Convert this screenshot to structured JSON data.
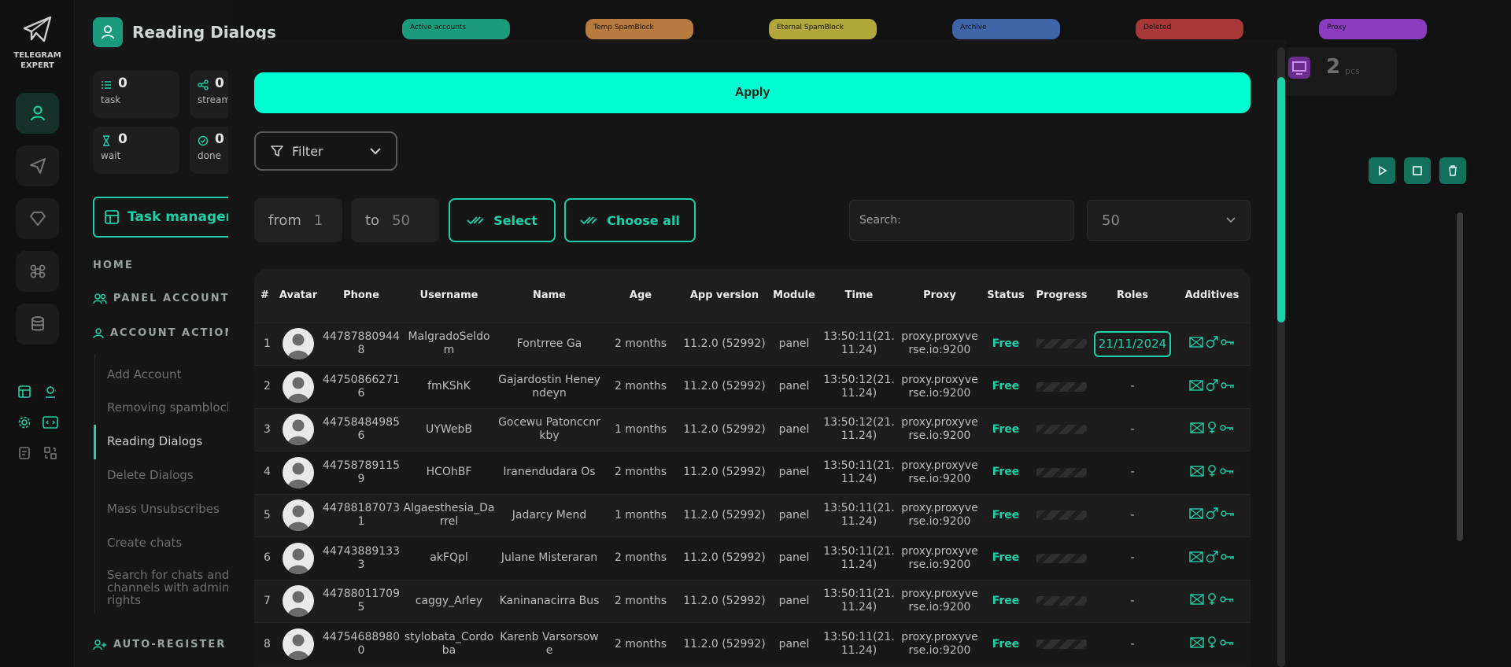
{
  "app": {
    "logo_line1": "TELEGRAM",
    "logo_line2": "EXPERT"
  },
  "page": {
    "title": "Reading Dialogs"
  },
  "stats": [
    {
      "value": "0",
      "label": "task"
    },
    {
      "value": "0",
      "label": "stream"
    },
    {
      "value": "0",
      "label": "wait"
    },
    {
      "value": "0",
      "label": "done"
    }
  ],
  "task_manager_label": "Task manager",
  "nav": {
    "home": "HOME",
    "panel_accounts": "PANEL ACCOUNTS",
    "account_action": "ACCOUNT ACTION",
    "items": [
      "Add Account",
      "Removing spamblock",
      "Reading Dialogs",
      "Delete Dialogs",
      "Mass Unsubscribes",
      "Create chats",
      "Search for chats and channels with admin rights"
    ],
    "auto_register": "AUTO-REGISTER"
  },
  "status_tabs": [
    {
      "label": "Active accounts",
      "color": "#1c9a7d"
    },
    {
      "label": "Temp SpamBlock",
      "color": "#b77a3f"
    },
    {
      "label": "Eternal SpamBlock",
      "color": "#b2a73a"
    },
    {
      "label": "Archive",
      "color": "#3f64a8"
    },
    {
      "label": "Deleted",
      "color": "#a83838"
    },
    {
      "label": "Proxy",
      "color": "#8a3dbf"
    }
  ],
  "proxy_card": {
    "value": "2",
    "unit": "pcs"
  },
  "modal": {
    "apply_label": "Apply",
    "filter_label": "Filter",
    "from_label": "from",
    "from_value": "1",
    "to_label": "to",
    "to_value": "50",
    "select_label": "Select",
    "choose_all_label": "Choose all",
    "search_placeholder": "Search:",
    "per_page": "50"
  },
  "table": {
    "headers": [
      "#",
      "Avatar",
      "Phone",
      "Username",
      "Name",
      "Age",
      "App version",
      "Module",
      "Time",
      "Proxy",
      "Status",
      "Progress",
      "Roles",
      "Additives"
    ],
    "rows": [
      {
        "num": "1",
        "phone": "447878809448",
        "username": "MalgradoSeldom",
        "name": "Fontrree Ga",
        "age": "2 months",
        "app": "11.2.0 (52992)",
        "module": "panel",
        "time": "13:50:11(21.11.24)",
        "proxy": "proxy.proxyverse.io:9200",
        "status": "Free",
        "roles": "21/11/2024",
        "gender": "male"
      },
      {
        "num": "2",
        "phone": "447508662716",
        "username": "fmKShK",
        "name": "Gajardostin Heneyndeyn",
        "age": "2 months",
        "app": "11.2.0 (52992)",
        "module": "panel",
        "time": "13:50:12(21.11.24)",
        "proxy": "proxy.proxyverse.io:9200",
        "status": "Free",
        "roles": "-",
        "gender": "male"
      },
      {
        "num": "3",
        "phone": "447584849856",
        "username": "UYWebB",
        "name": "Gocewu Patonccnrkby",
        "age": "1 months",
        "app": "11.2.0 (52992)",
        "module": "panel",
        "time": "13:50:12(21.11.24)",
        "proxy": "proxy.proxyverse.io:9200",
        "status": "Free",
        "roles": "-",
        "gender": "female"
      },
      {
        "num": "4",
        "phone": "447587891159",
        "username": "HCOhBF",
        "name": "Iranendudara Os",
        "age": "2 months",
        "app": "11.2.0 (52992)",
        "module": "panel",
        "time": "13:50:11(21.11.24)",
        "proxy": "proxy.proxyverse.io:9200",
        "status": "Free",
        "roles": "-",
        "gender": "female"
      },
      {
        "num": "5",
        "phone": "447881870731",
        "username": "Algaesthesia_Darrel",
        "name": "Jadarcy Mend",
        "age": "1 months",
        "app": "11.2.0 (52992)",
        "module": "panel",
        "time": "13:50:11(21.11.24)",
        "proxy": "proxy.proxyverse.io:9200",
        "status": "Free",
        "roles": "-",
        "gender": "male"
      },
      {
        "num": "6",
        "phone": "447438891333",
        "username": "akFQpl",
        "name": "Julane Misteraran",
        "age": "2 months",
        "app": "11.2.0 (52992)",
        "module": "panel",
        "time": "13:50:11(21.11.24)",
        "proxy": "proxy.proxyverse.io:9200",
        "status": "Free",
        "roles": "-",
        "gender": "male"
      },
      {
        "num": "7",
        "phone": "447880117095",
        "username": "caggy_Arley",
        "name": "Kaninanacirra Bus",
        "age": "2 months",
        "app": "11.2.0 (52992)",
        "module": "panel",
        "time": "13:50:11(21.11.24)",
        "proxy": "proxy.proxyverse.io:9200",
        "status": "Free",
        "roles": "-",
        "gender": "female"
      },
      {
        "num": "8",
        "phone": "447546889800",
        "username": "stylobata_Cordoba",
        "name": "Karenb Varsorsowe",
        "age": "2 months",
        "app": "11.2.0 (52992)",
        "module": "panel",
        "time": "13:50:11(21.11.24)",
        "proxy": "proxy.proxyverse.io:9200",
        "status": "Free",
        "roles": "-",
        "gender": "female"
      }
    ]
  },
  "colors": {
    "accent": "#1cd0a8",
    "apply": "#00ffd1",
    "bg": "#121212"
  }
}
